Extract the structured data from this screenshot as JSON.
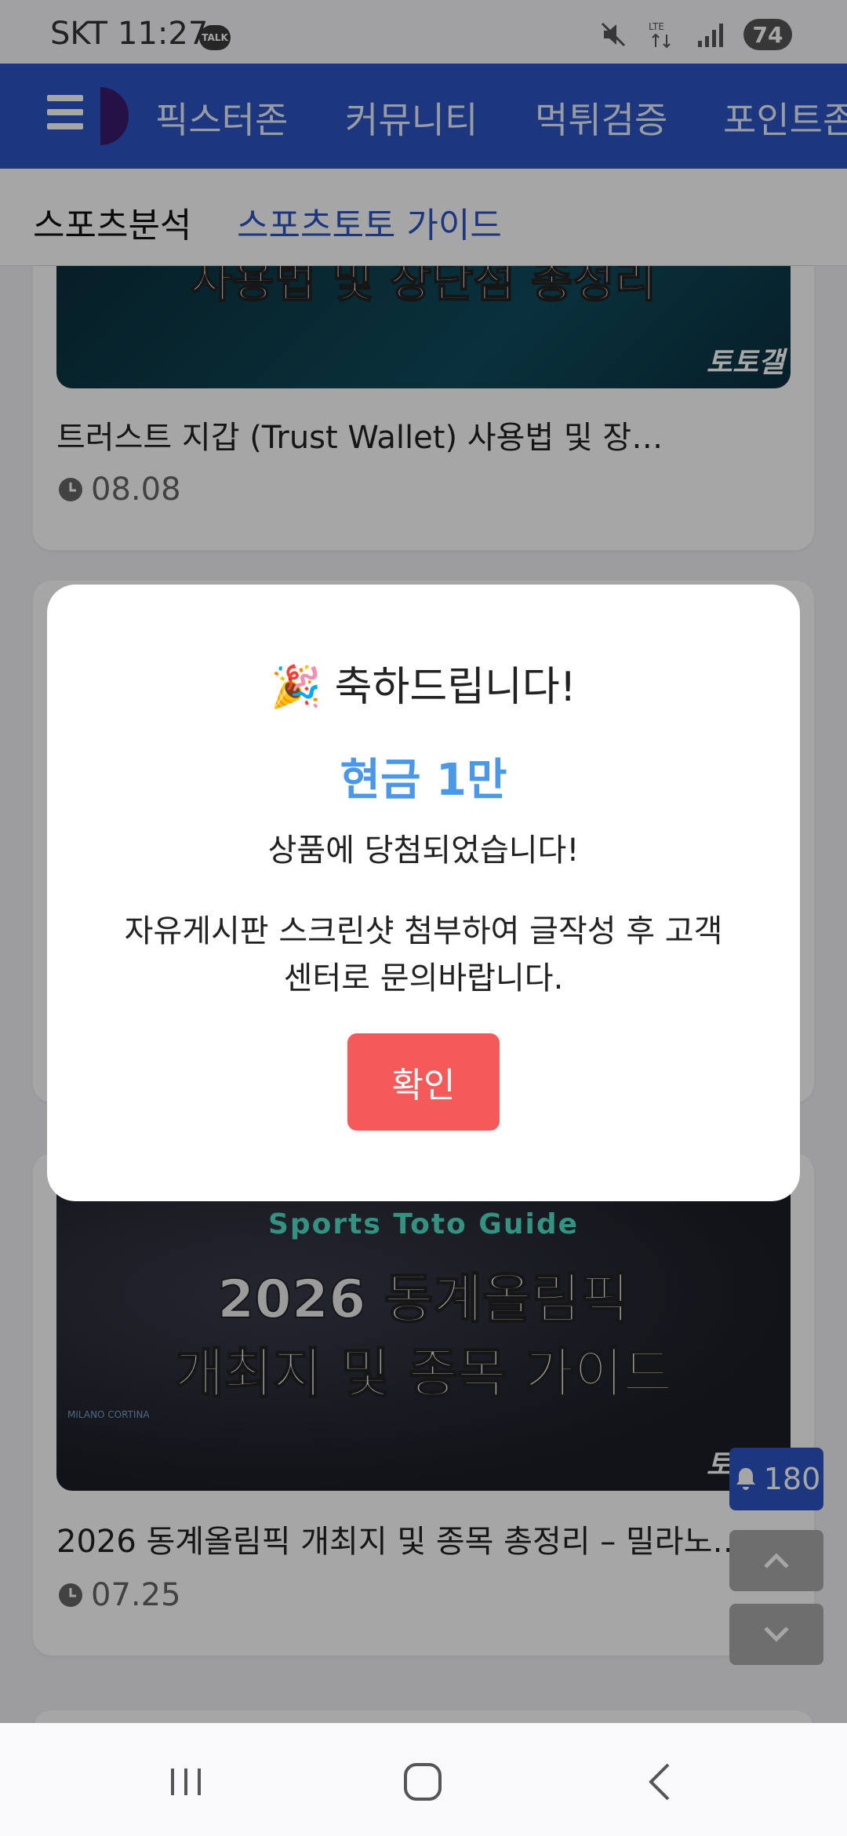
{
  "status_bar": {
    "carrier": "SKT",
    "time": "11:27",
    "talk_label": "TALK",
    "battery": "74",
    "network": "LTE"
  },
  "top_nav": {
    "items": [
      "픽스터존",
      "커뮤니티",
      "먹튀검증",
      "포인트존"
    ]
  },
  "sub_nav": {
    "items": [
      "스포츠분석",
      "스포츠토토 가이드"
    ]
  },
  "cards": [
    {
      "title": "트러스트 지갑 (Trust Wallet) 사용법 및 장…",
      "date": "08.08",
      "thumb_text": "사용법 및 장단점 총정리",
      "brand": "토토갤"
    },
    {
      "title": "2026 동계올림픽 개최지 및 종목 총정리 – 밀라노…",
      "date": "07.25",
      "thumb_sub": "Sports Toto Guide",
      "thumb_line1": "2026 동계올림픽",
      "thumb_line2": "개최지 및 종목 가이드",
      "brand": "토토갤",
      "emblem": "MILANO CORTINA"
    }
  ],
  "floating": {
    "notification_count": "180"
  },
  "modal": {
    "title": "🎉 축하드립니다!",
    "prize": "현금 1만",
    "message": "상품에 당첨되었습니다!",
    "description": "자유게시판 스크린샷 첨부하여 글작성 후 고객센터로 문의바랍니다.",
    "confirm_label": "확인"
  },
  "colors": {
    "nav_blue": "#2b55c3",
    "prize_blue": "#4b97e8",
    "confirm_red": "#f55a5a"
  }
}
